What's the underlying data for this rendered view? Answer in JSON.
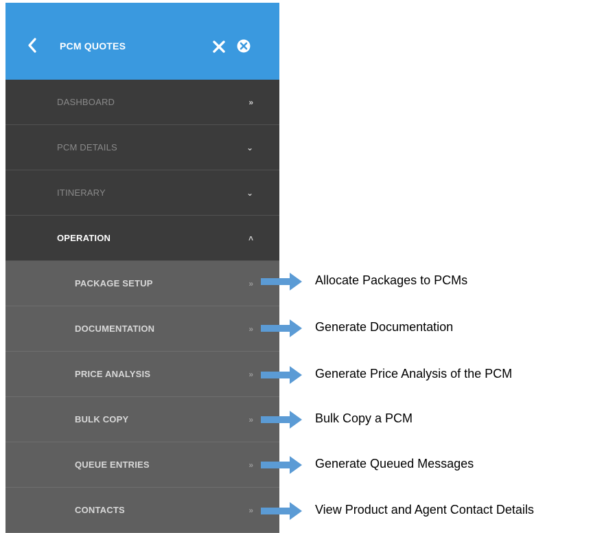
{
  "header": {
    "title": "PCM QUOTES",
    "accent_color": "#3a99df",
    "back_icon": "chevron-left-icon",
    "close_icon": "close-icon",
    "cancel_icon": "cancel-circle-icon"
  },
  "menu": {
    "items": [
      {
        "label": "DASHBOARD",
        "glyph": "»"
      },
      {
        "label": "PCM DETAILS",
        "glyph": "⌄"
      },
      {
        "label": "ITINERARY",
        "glyph": "⌄"
      },
      {
        "label": "OPERATION",
        "glyph": "˄"
      }
    ],
    "subitems": [
      {
        "label": "PACKAGE SETUP",
        "glyph": "»"
      },
      {
        "label": "DOCUMENTATION",
        "glyph": "»"
      },
      {
        "label": "PRICE ANALYSIS",
        "glyph": "»"
      },
      {
        "label": "BULK COPY",
        "glyph": "»"
      },
      {
        "label": "QUEUE ENTRIES",
        "glyph": "»"
      },
      {
        "label": "CONTACTS",
        "glyph": "»"
      }
    ]
  },
  "callouts": [
    "Allocate Packages to PCMs",
    "Generate Documentation",
    "Generate Price Analysis of the PCM",
    "Bulk Copy a PCM",
    "Generate Queued Messages",
    "View Product and Agent Contact Details"
  ],
  "colors": {
    "dark_row": "#3b3b3b",
    "light_row": "#5f5f5f",
    "arrow": "#5b9bd5"
  }
}
